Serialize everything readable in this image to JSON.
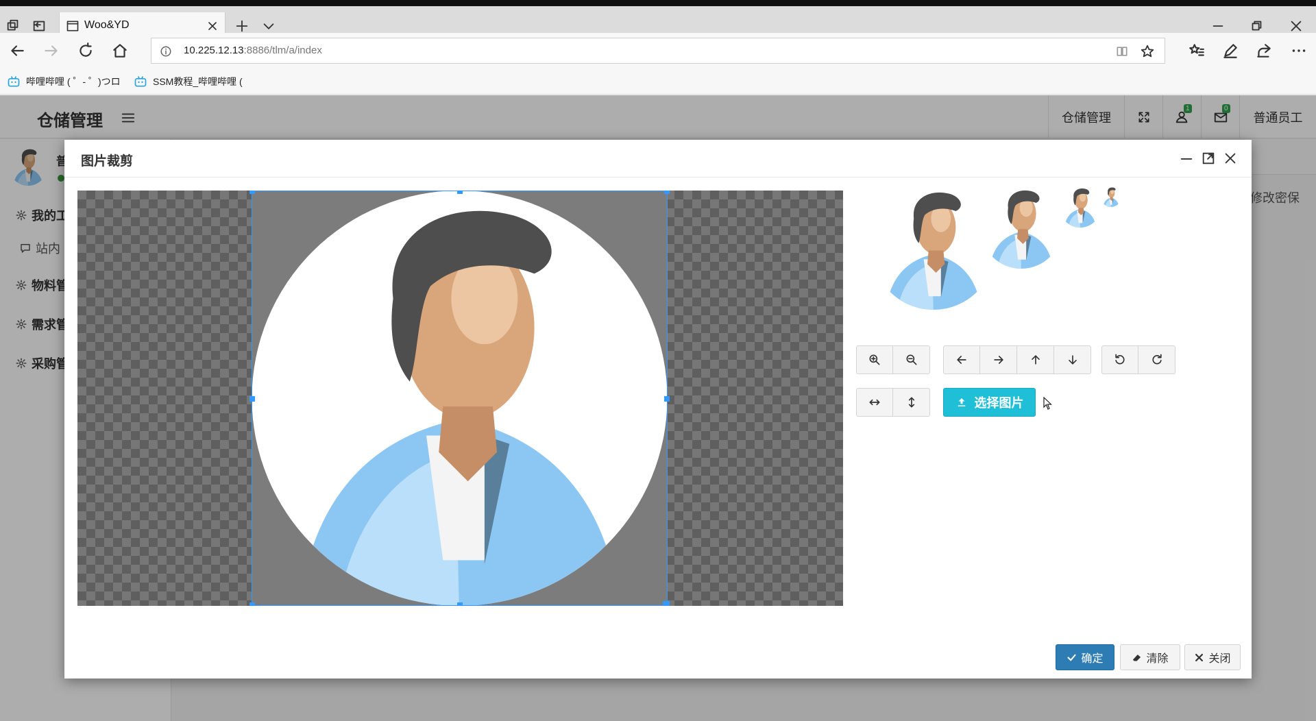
{
  "browser": {
    "tab_title": "Woo&YD",
    "url_host": "10.225.12.13",
    "url_rest": ":8886/tlm/a/index",
    "bookmarks": [
      "哔哩哔哩 ( ゜- ゜)つロ",
      "SSM教程_哔哩哔哩 ("
    ]
  },
  "app": {
    "brand": "仓储管理",
    "header_items": {
      "warehouse": "仓储管理",
      "notify_count": "1",
      "mail_count": "0",
      "user_role": "普通员工"
    },
    "sidebar": {
      "user_name": "普",
      "items": [
        {
          "label": "我的工"
        },
        {
          "label": "站内"
        },
        {
          "label": "物料管"
        },
        {
          "label": "需求管"
        },
        {
          "label": "采购管"
        }
      ]
    },
    "right_link": "修改密保"
  },
  "modal": {
    "title": "图片裁剪",
    "choose_label": "选择图片",
    "ok_label": "确定",
    "clear_label": "清除",
    "close_label": "关闭"
  },
  "colors": {
    "accent_blue": "#2d7cb3",
    "info_cyan": "#1fbfd8",
    "badge_green": "#2fa34c",
    "crop_border": "#3399ff"
  }
}
